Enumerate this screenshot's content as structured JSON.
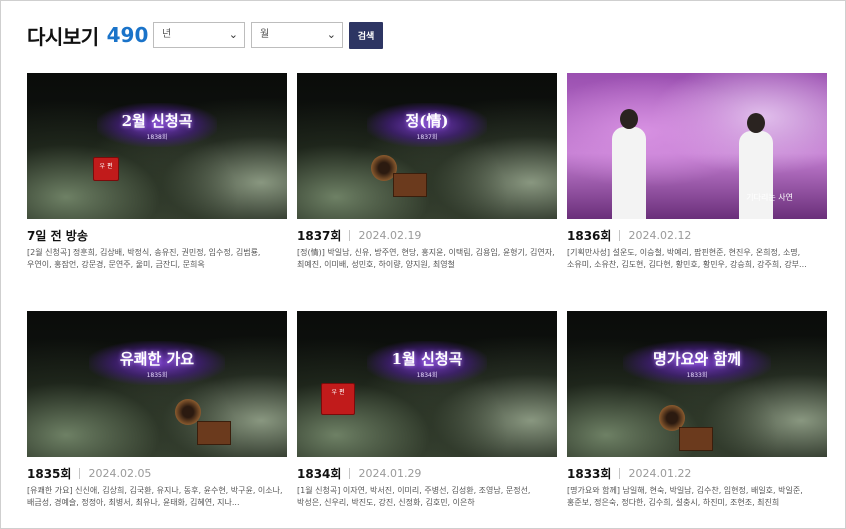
{
  "header": {
    "title": "다시보기",
    "count": "490"
  },
  "filters": {
    "year": {
      "selected": "년"
    },
    "month": {
      "selected": "월"
    },
    "search_label": "검색"
  },
  "episodes": [
    {
      "thumb_title": "2월 신청곡",
      "thumb_sub": "1838회",
      "ep": "7일 전 방송",
      "date": "",
      "desc": "[2월 신청곡] 정훈희, 김상배, 박정식, 송유진, 권민정, 임수정, 김범룡, 우연이, 홍잠언, 강문경, 문연주, 울미, 금잔디, 문희옥"
    },
    {
      "thumb_title": "정(情)",
      "thumb_sub": "1837회",
      "ep": "1837회",
      "date": "2024.02.19",
      "desc": "[정(情)] 박일남, 신유, 방주연, 현당, 홍지윤, 이택림, 김용임, 윤형기, 김연자, 최예진, 이미배, 성민호, 하이량, 양지원, 최영철"
    },
    {
      "thumb_title": "",
      "thumb_sub": "기다리는 사연",
      "ep": "1836회",
      "date": "2024.02.12",
      "desc": "[기획만사성] 설운도, 이승철, 박예리, 팝핀현준, 현진우, 온희정, 소명, 소유미, 소유찬, 김도현, 김다현, 황민호, 황민우, 강승희, 강주희, 강부..."
    },
    {
      "thumb_title": "유쾌한 가요",
      "thumb_sub": "1835회",
      "ep": "1835회",
      "date": "2024.02.05",
      "desc": "[유쾌한 가요] 신신애, 김상희, 김국환, 유지나, 동후, 윤수현, 박구윤, 이소나, 배금성, 경예슬, 정정아, 최병서, 최유나, 윤태화, 김혜연, 지나..."
    },
    {
      "thumb_title": "1월 신청곡",
      "thumb_sub": "1834회",
      "ep": "1834회",
      "date": "2024.01.29",
      "desc": "[1월 신청곡] 이자연, 박서진, 이미리, 주병선, 김성환, 조영남, 문정선, 박성은, 신우리, 박진도, 강진, 신정화, 김호민, 이은하"
    },
    {
      "thumb_title": "명가요와 함께",
      "thumb_sub": "1833회",
      "ep": "1833회",
      "date": "2024.01.22",
      "desc": "[명가요와 함께] 남일해, 현숙, 박일남, 김수찬, 임현정, 배일호, 박일준, 홍준보, 정은숙, 정다한, 김수희, 설충시, 하진미, 조현조, 최진희"
    }
  ]
}
